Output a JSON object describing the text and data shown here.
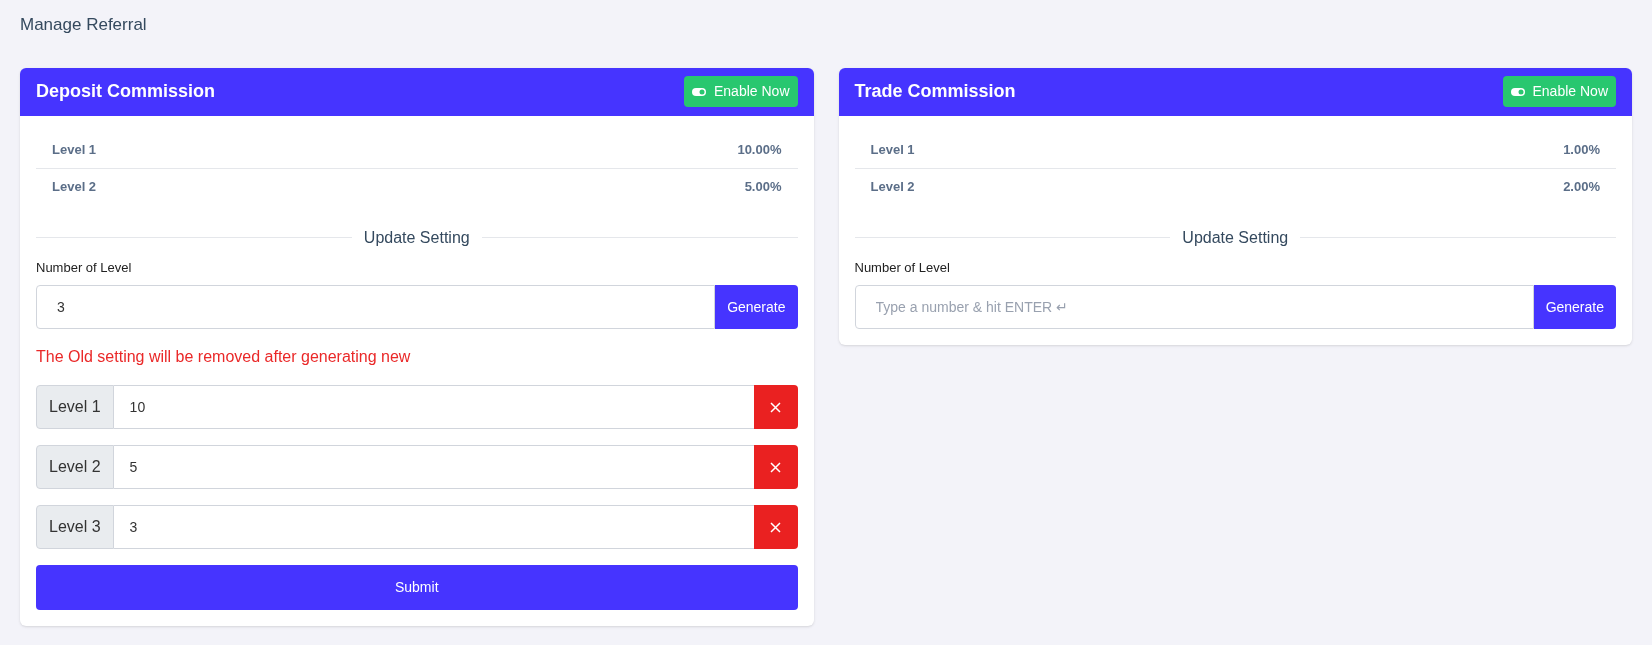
{
  "page_title": "Manage Referral",
  "cards": [
    {
      "title": "Deposit Commission",
      "enable_button": "Enable Now",
      "levels": [
        {
          "label": "Level 1",
          "value": "10.00%"
        },
        {
          "label": "Level 2",
          "value": "5.00%"
        }
      ],
      "divider": "Update Setting",
      "field_label": "Number of Level",
      "field": {
        "value": "3"
      },
      "generate_button": "Generate",
      "warning": "The Old setting will be removed after generating new",
      "level_inputs": [
        {
          "label": "Level 1",
          "value": "10"
        },
        {
          "label": "Level 2",
          "value": "5"
        },
        {
          "label": "Level 3",
          "value": "3"
        }
      ],
      "submit_button": "Submit"
    },
    {
      "title": "Trade Commission",
      "enable_button": "Enable Now",
      "levels": [
        {
          "label": "Level 1",
          "value": "1.00%"
        },
        {
          "label": "Level 2",
          "value": "2.00%"
        }
      ],
      "divider": "Update Setting",
      "field_label": "Number of Level",
      "field": {
        "placeholder": "Type a number & hit ENTER ↵"
      },
      "generate_button": "Generate"
    }
  ]
}
